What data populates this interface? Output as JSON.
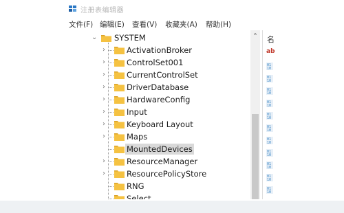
{
  "window": {
    "title": "注册表编辑器"
  },
  "menu": [
    {
      "label": "文件(F)"
    },
    {
      "label": "编辑(E)"
    },
    {
      "label": "查看(V)"
    },
    {
      "label": "收藏夹(A)"
    },
    {
      "label": "帮助(H)"
    }
  ],
  "tree": {
    "root": {
      "label": "SYSTEM",
      "expanded": true
    },
    "children": [
      {
        "label": "ActivationBroker",
        "has_children": true
      },
      {
        "label": "ControlSet001",
        "has_children": true
      },
      {
        "label": "CurrentControlSet",
        "has_children": true
      },
      {
        "label": "DriverDatabase",
        "has_children": true
      },
      {
        "label": "HardwareConfig",
        "has_children": true
      },
      {
        "label": "Input",
        "has_children": true
      },
      {
        "label": "Keyboard Layout",
        "has_children": true
      },
      {
        "label": "Maps",
        "has_children": true
      },
      {
        "label": "MountedDevices",
        "has_children": false,
        "selected": true
      },
      {
        "label": "ResourceManager",
        "has_children": true
      },
      {
        "label": "ResourcePolicyStore",
        "has_children": true
      },
      {
        "label": "RNG",
        "has_children": false
      },
      {
        "label": "Select",
        "has_children": false
      }
    ]
  },
  "right_pane": {
    "column_header": "名",
    "first_value_icon": "ab"
  },
  "colors": {
    "folder": "#f5c242",
    "folder_dark": "#d9a22a",
    "selected_bg": "#d9d9d9",
    "value_icon": "#2f7fc1"
  }
}
